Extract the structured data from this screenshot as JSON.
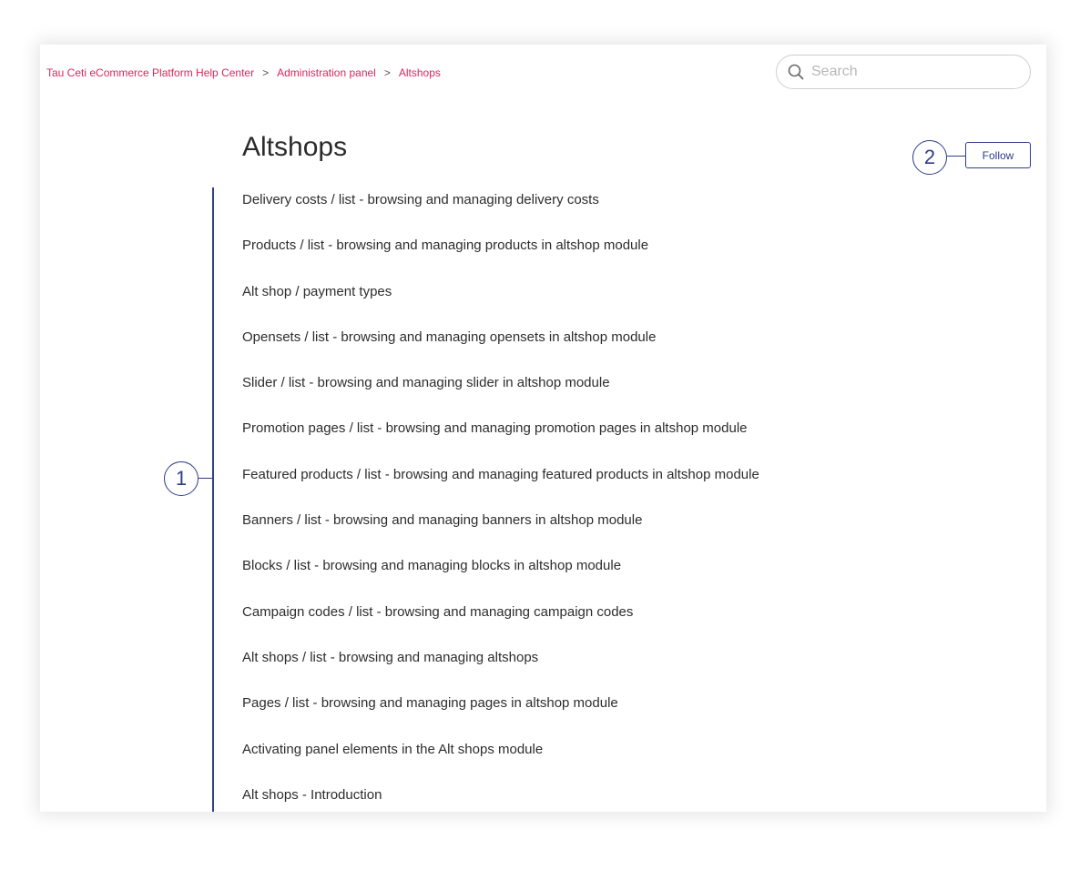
{
  "breadcrumb": {
    "items": [
      "Tau Ceti eCommerce Platform Help Center",
      "Administration panel",
      "Altshops"
    ],
    "separator": ">"
  },
  "search": {
    "placeholder": "Search",
    "icon": "search-icon"
  },
  "section": {
    "title": "Altshops",
    "follow_label": "Follow",
    "articles": [
      "Delivery costs / list - browsing and managing delivery costs",
      "Products / list - browsing and managing products in altshop module",
      "Alt shop / payment types",
      "Opensets / list - browsing and managing opensets in altshop module",
      "Slider / list - browsing and managing slider in altshop module",
      "Promotion pages / list - browsing and managing promotion pages in altshop module",
      "Featured products / list - browsing and managing featured products in altshop module",
      "Banners / list - browsing and managing banners in altshop module",
      "Blocks / list - browsing and managing blocks in altshop module",
      "Campaign codes / list - browsing and managing campaign codes",
      "Alt shops / list - browsing and managing altshops",
      "Pages / list - browsing and managing pages in altshop module",
      "Activating panel elements in the Alt shops module",
      "Alt shops - Introduction"
    ]
  },
  "callouts": {
    "one": "1",
    "two": "2"
  },
  "colors": {
    "link": "#e0245e",
    "annotation": "#2f3d8a",
    "text": "#2d2d2d"
  }
}
